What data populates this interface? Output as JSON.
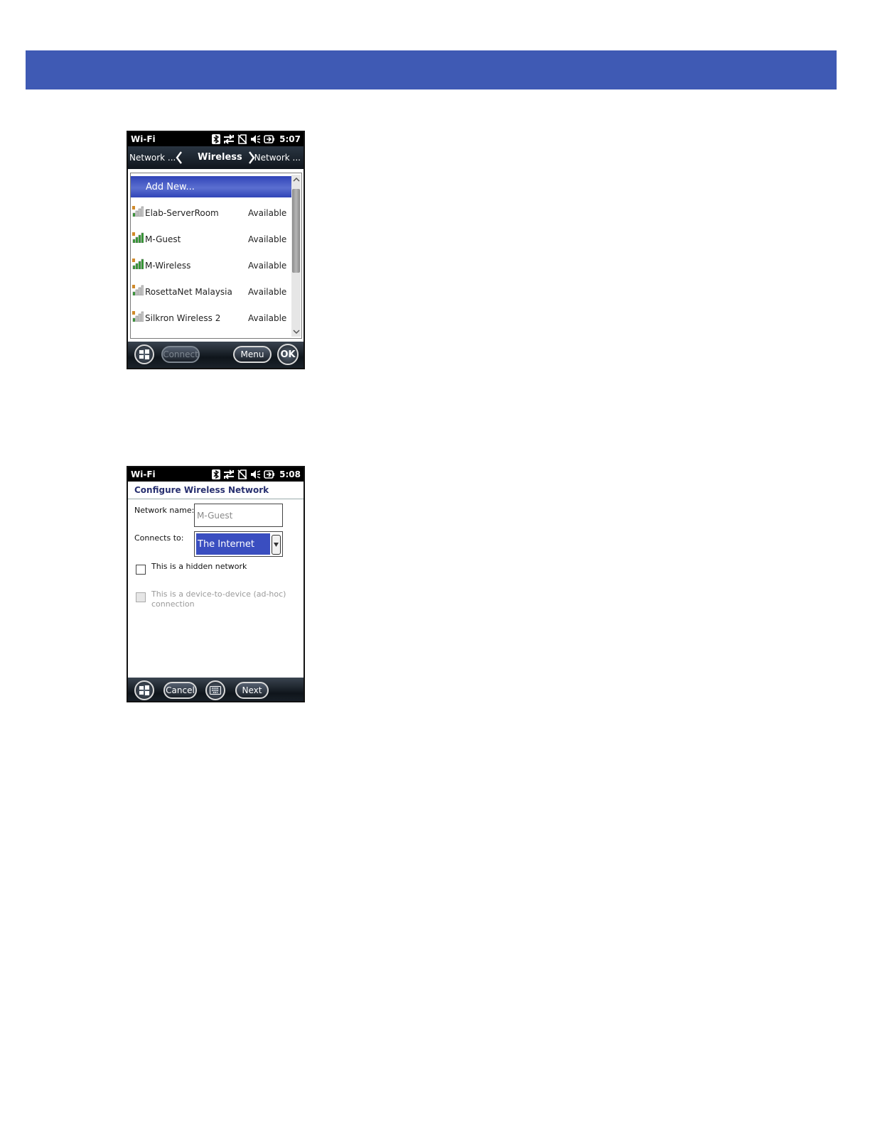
{
  "colors": {
    "banner": "#3f5ab4",
    "selection": "#3a4ec0",
    "title_text": "#283070"
  },
  "screen1": {
    "status": {
      "title": "Wi-Fi",
      "time": "5:07",
      "icons": [
        "bluetooth-icon",
        "data-transfer-icon",
        "no-sim-icon",
        "speaker-muted-icon",
        "battery-charging-icon"
      ]
    },
    "tabs": {
      "left": "Network ...",
      "center": "Wireless",
      "right": "Network ..."
    },
    "add_new": "Add New...",
    "networks": [
      {
        "name": "Elab-ServerRoom",
        "status": "Available",
        "signal": 1
      },
      {
        "name": "M-Guest",
        "status": "Available",
        "signal": 4
      },
      {
        "name": "M-Wireless",
        "status": "Available",
        "signal": 4
      },
      {
        "name": "RosettaNet Malaysia",
        "status": "Available",
        "signal": 1
      },
      {
        "name": "Silkron Wireless 2",
        "status": "Available",
        "signal": 1
      }
    ],
    "softkeys": {
      "connect": "Connect",
      "menu": "Menu",
      "ok": "OK"
    }
  },
  "screen2": {
    "status": {
      "title": "Wi-Fi",
      "time": "5:08"
    },
    "title": "Configure Wireless Network",
    "network_name_label": "Network name:",
    "network_name_value": "M-Guest",
    "connects_to_label": "Connects to:",
    "connects_to_value": "The Internet",
    "hidden_label": "This is a hidden network",
    "adhoc_label": "This is a device-to-device (ad-hoc) connection",
    "softkeys": {
      "cancel": "Cancel",
      "next": "Next"
    }
  }
}
